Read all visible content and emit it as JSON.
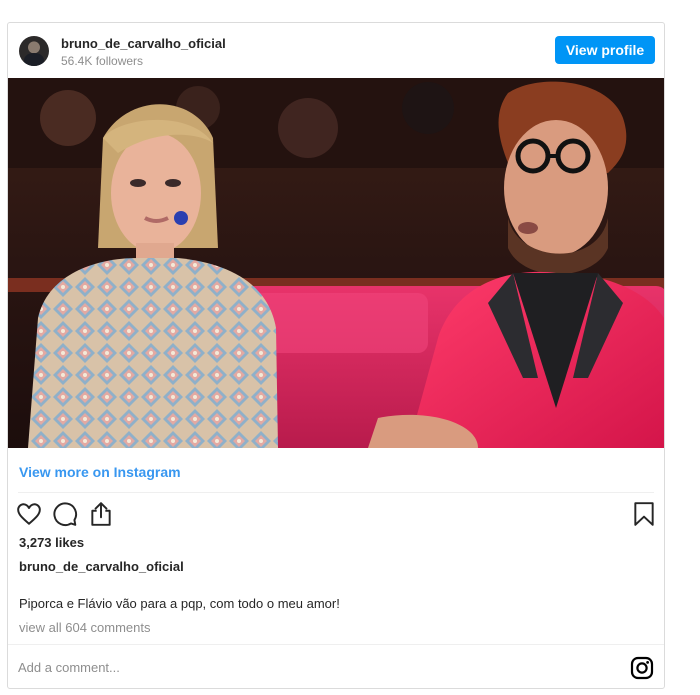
{
  "header": {
    "username": "bruno_de_carvalho_oficial",
    "followers": "56.4K followers",
    "view_profile_label": "View profile"
  },
  "media": {
    "description_icon": "post-photo"
  },
  "links": {
    "view_more": "View more on Instagram"
  },
  "actions": {
    "like_icon": "heart-icon",
    "comment_icon": "comment-icon",
    "share_icon": "share-icon",
    "save_icon": "bookmark-icon"
  },
  "post": {
    "likes": "3,273 likes",
    "caption_user": "bruno_de_carvalho_oficial",
    "caption_text": "Piporca e Flávio vão para a pqp, com todo o meu amor!",
    "comments_link": "view all 604 comments"
  },
  "comment": {
    "placeholder": "Add a comment..."
  },
  "colors": {
    "accent": "#0095f6",
    "link": "#3897f0",
    "muted": "#8e8e8e",
    "border": "#dbdbdb"
  }
}
